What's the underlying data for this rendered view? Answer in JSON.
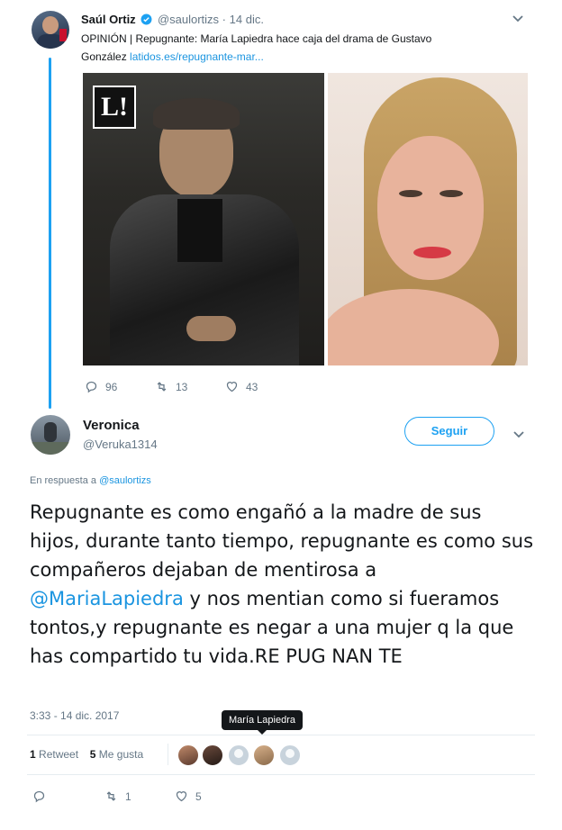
{
  "retweet": {
    "author_name": "Saúl Ortiz",
    "author_handle": "@saulortizs",
    "time": "14 dic.",
    "separator": "·",
    "text_line1": "OPINIÓN | Repugnante: María Lapiedra hace caja del drama de Gustavo",
    "text_line2": "González",
    "link": "latidos.es/repugnante-mar...",
    "media_logo": "L!",
    "replies": "96",
    "retweets": "13",
    "likes": "43"
  },
  "tweet": {
    "author_name": "Veronica",
    "author_handle": "@Veruka1314",
    "follow_label": "Seguir",
    "reply_prefix": "En respuesta a",
    "reply_to": "@saulortizs",
    "text_before": "Repugnante es como engañó a la madre de sus hijos, durante tanto tiempo, repugnante es como sus compañeros dejaban de mentirosa a ",
    "mention": "@MariaLapiedra",
    "text_after": " y nos mentian como si fueramos tontos,y repugnante es negar a una mujer q la que has compartido tu vida.RE PUG NAN TE",
    "timestamp": "3:33 - 14 dic. 2017",
    "retweet_count": "1",
    "retweet_label": "Retweet",
    "like_count": "5",
    "like_label": "Me gusta",
    "tooltip": "María Lapiedra",
    "action_retweets": "1",
    "action_likes": "5"
  },
  "colors": {
    "accent": "#1da1f2",
    "link": "#1b95e0",
    "text": "#14171a",
    "muted": "#657786"
  },
  "icons": [
    "verified-icon",
    "chevron-down-icon",
    "reply-icon",
    "retweet-icon",
    "heart-icon"
  ]
}
